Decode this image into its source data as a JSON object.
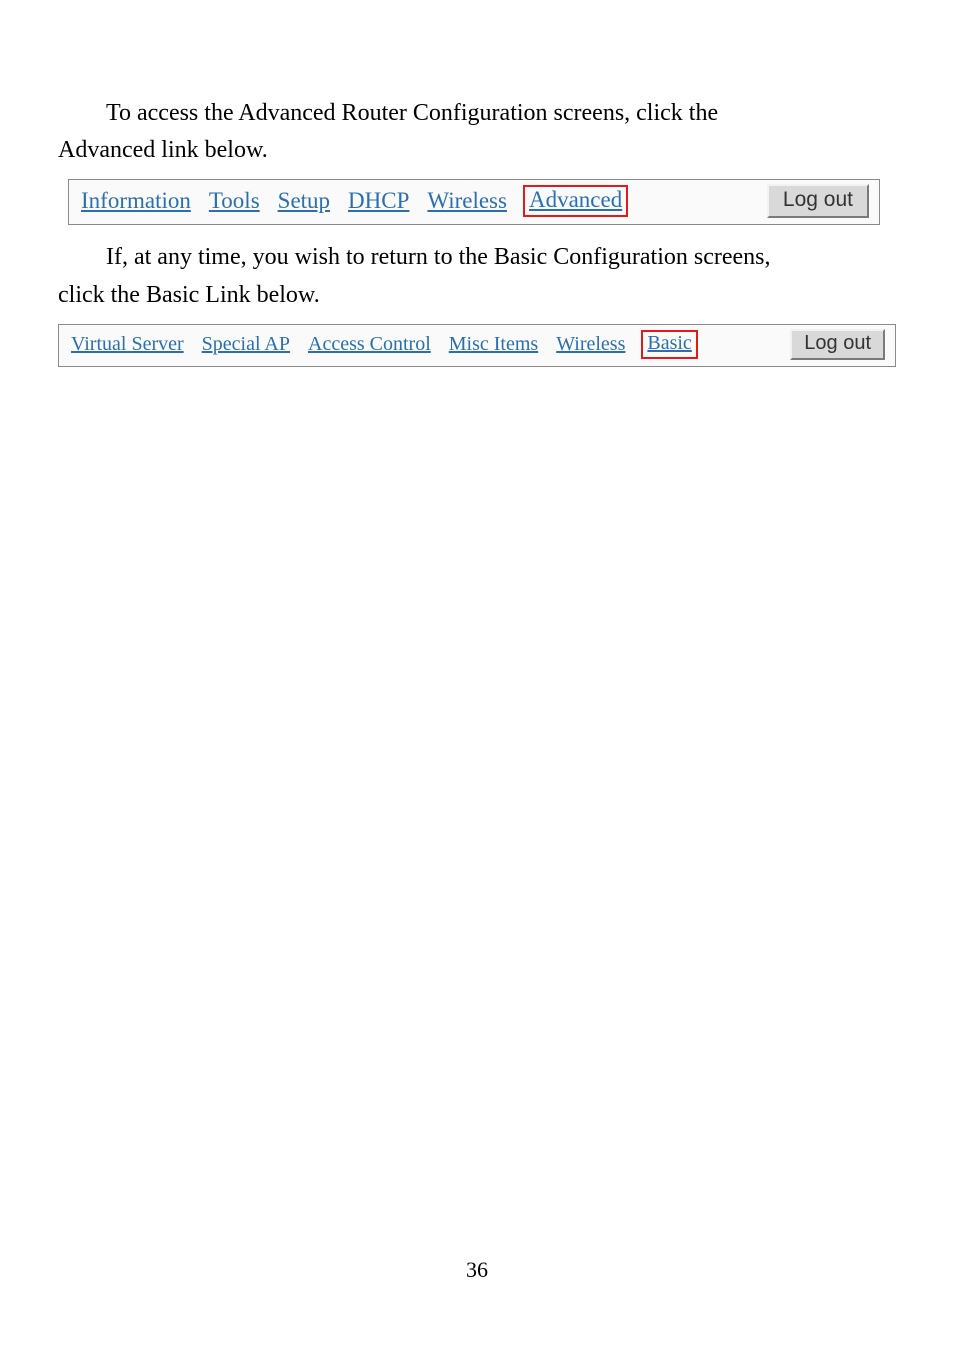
{
  "para1_line1": "To access the Advanced Router Configuration screens, click the",
  "para1_line2": "Advanced link below.",
  "nav1": {
    "items": [
      "Information",
      "Tools",
      "Setup",
      "DHCP",
      "Wireless",
      "Advanced"
    ],
    "highlight_index": 5,
    "logout": "Log out"
  },
  "para2_line1": "If, at any time, you wish to return to the Basic Configuration screens,",
  "para2_line2": "click the Basic Link below.",
  "nav2": {
    "items": [
      "Virtual Server",
      "Special AP",
      "Access Control",
      "Misc Items",
      "Wireless",
      "Basic"
    ],
    "highlight_index": 5,
    "logout": "Log out"
  },
  "page_number": "36"
}
